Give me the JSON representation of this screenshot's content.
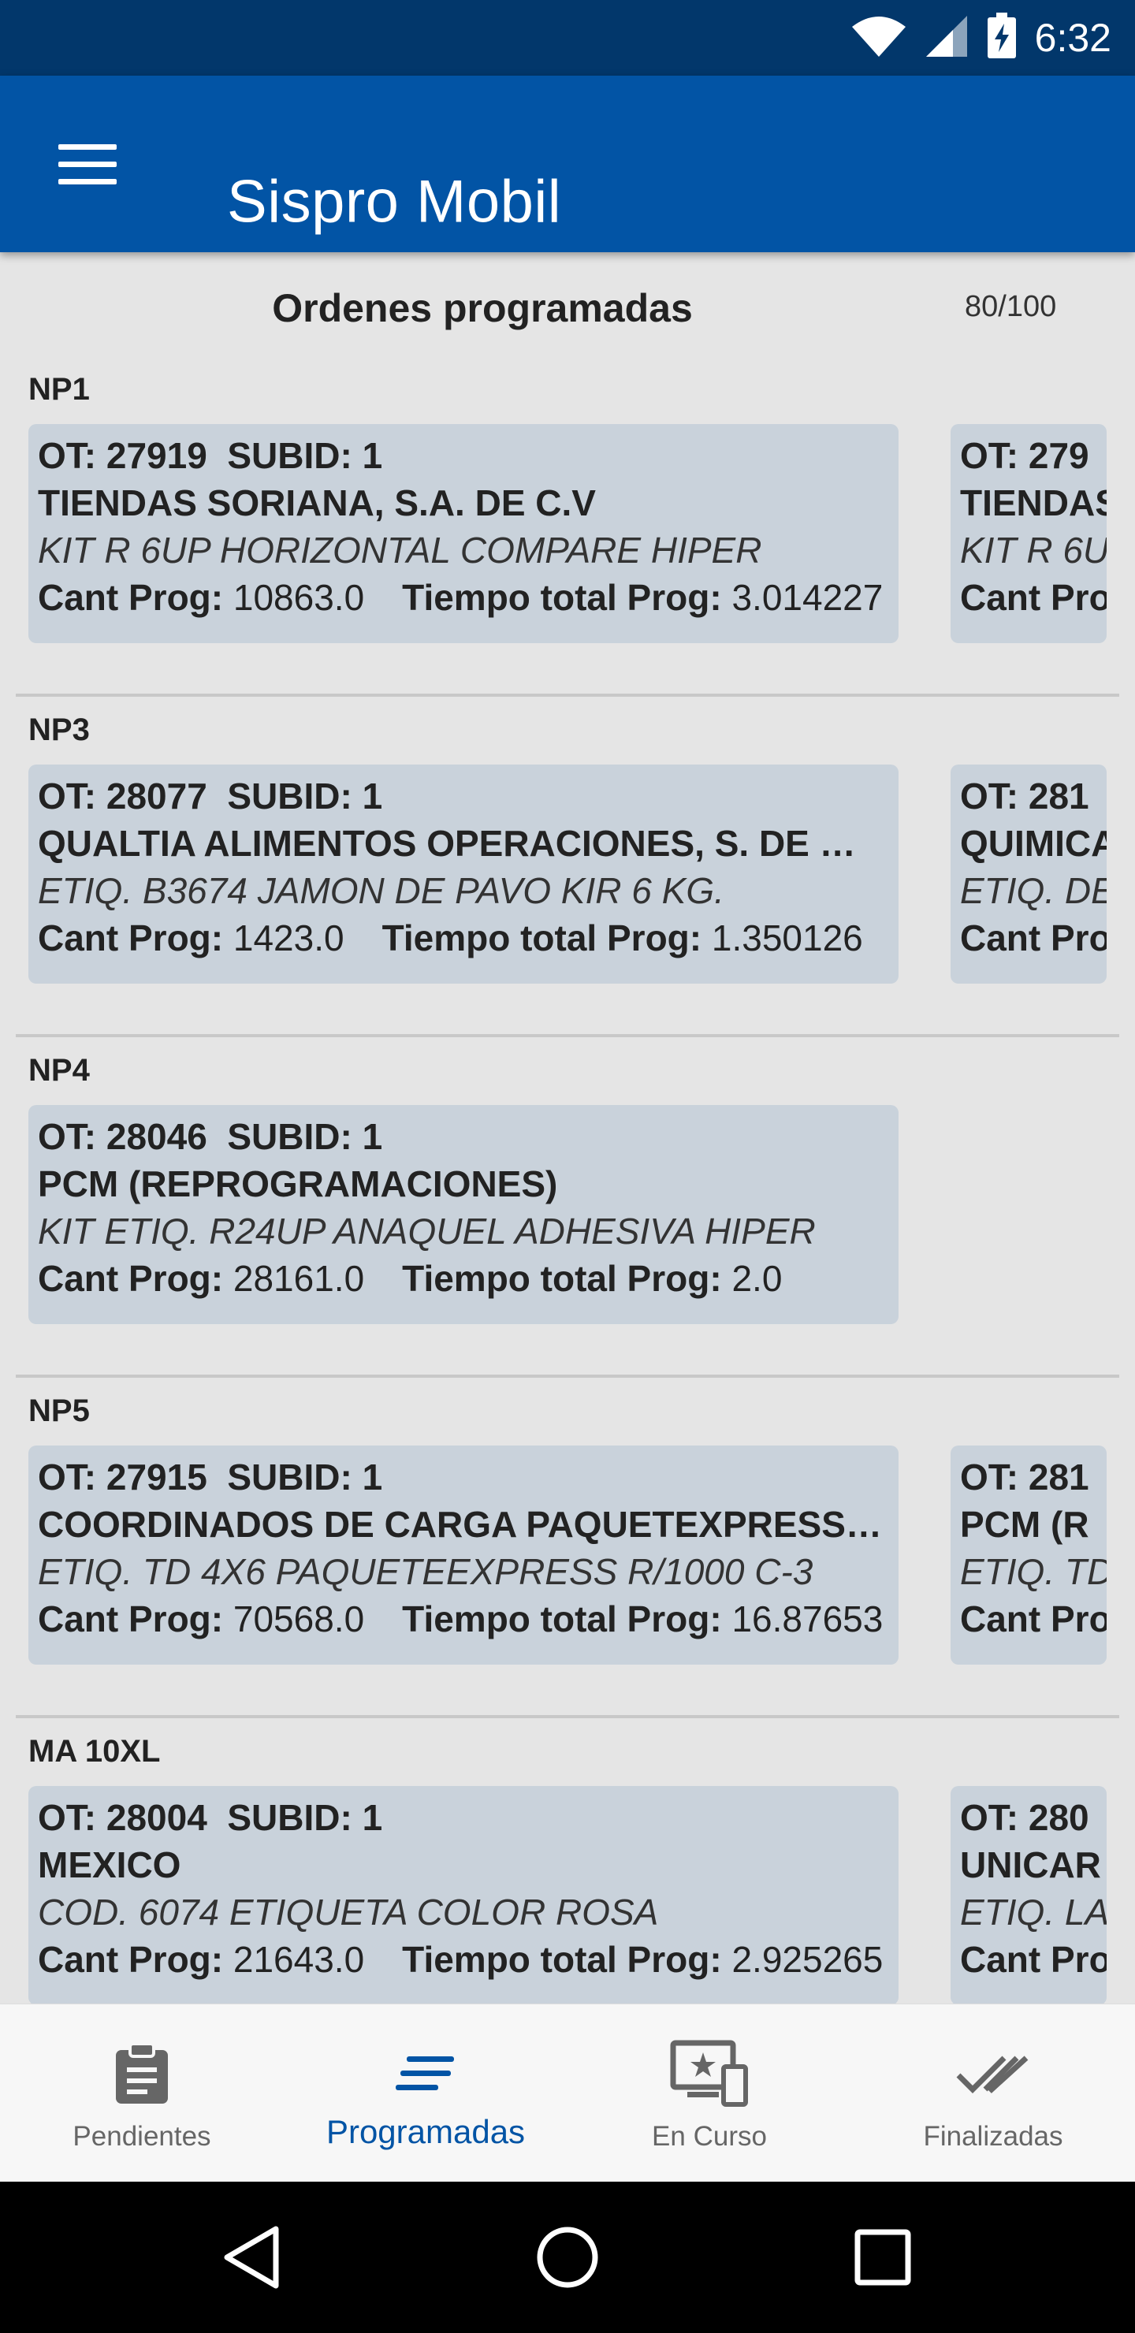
{
  "status_bar": {
    "time": "6:32",
    "icons": [
      "wifi-icon",
      "cell-signal-icon",
      "battery-charging-icon"
    ]
  },
  "app_bar": {
    "title": "Sispro Mobil",
    "menu_icon": "hamburger-menu-icon"
  },
  "page": {
    "title": "Ordenes programadas",
    "count": "80/100"
  },
  "sections": [
    {
      "name": "NP1",
      "cards": [
        {
          "ot_label": "OT:",
          "ot": "27919",
          "subid_label": "SUBID:",
          "subid": "1",
          "client": "TIENDAS SORIANA, S.A. DE C.V",
          "product": "KIT R 6UP HORIZONTAL COMPARE HIPER",
          "cant_label": "Cant Prog:",
          "cant": "10863.0",
          "tiempo_label": "Tiempo total Prog:",
          "tiempo": "3.014227"
        },
        {
          "ot_label": "OT:",
          "ot": "279",
          "client": "TIENDAS",
          "product": "KIT R 6U",
          "cant_label": "Cant Pro"
        }
      ]
    },
    {
      "name": "NP3",
      "cards": [
        {
          "ot_label": "OT:",
          "ot": "28077",
          "subid_label": "SUBID:",
          "subid": "1",
          "client": "QUALTIA ALIMENTOS OPERACIONES, S. DE …",
          "product": "ETIQ. B3674 JAMON DE PAVO KIR 6 KG.",
          "cant_label": "Cant Prog:",
          "cant": "1423.0",
          "tiempo_label": "Tiempo total Prog:",
          "tiempo": "1.350126"
        },
        {
          "ot_label": "OT:",
          "ot": "281",
          "client": "QUIMICA",
          "product": "ETIQ. DE",
          "cant_label": "Cant Pro"
        }
      ]
    },
    {
      "name": "NP4",
      "cards": [
        {
          "ot_label": "OT:",
          "ot": "28046",
          "subid_label": "SUBID:",
          "subid": "1",
          "client": "PCM  (REPROGRAMACIONES)",
          "product": "KIT ETIQ. R24UP ANAQUEL ADHESIVA HIPER",
          "cant_label": "Cant Prog:",
          "cant": "28161.0",
          "tiempo_label": "Tiempo total Prog:",
          "tiempo": "2.0"
        }
      ]
    },
    {
      "name": "NP5",
      "cards": [
        {
          "ot_label": "OT:",
          "ot": "27915",
          "subid_label": "SUBID:",
          "subid": "1",
          "client": "COORDINADOS DE CARGA PAQUETEXPRESS …",
          "product": "ETIQ. TD 4X6 PAQUETEEXPRESS R/1000 C-3",
          "cant_label": "Cant Prog:",
          "cant": "70568.0",
          "tiempo_label": "Tiempo total Prog:",
          "tiempo": "16.87653"
        },
        {
          "ot_label": "OT:",
          "ot": "281",
          "client": "PCM  (R",
          "product": "ETIQ. TD",
          "cant_label": "Cant Pro"
        }
      ]
    },
    {
      "name": "MA 10XL",
      "cards": [
        {
          "ot_label": "OT:",
          "ot": "28004",
          "subid_label": "SUBID:",
          "subid": "1",
          "client": "MEXICO",
          "product": "COD. 6074 ETIQUETA COLOR ROSA",
          "cant_label": "Cant Prog:",
          "cant": "21643.0",
          "tiempo_label": "Tiempo total Prog:",
          "tiempo": "2.925265"
        },
        {
          "ot_label": "OT:",
          "ot": "280",
          "client": "UNICAR",
          "product": "ETIQ. LA",
          "cant_label": "Cant Pro"
        }
      ]
    }
  ],
  "bottom_nav": [
    {
      "label": "Pendientes",
      "icon": "clipboard-icon",
      "active": false
    },
    {
      "label": "Programadas",
      "icon": "schedule-lines-icon",
      "active": true
    },
    {
      "label": "En Curso",
      "icon": "devices-star-icon",
      "active": false
    },
    {
      "label": "Finalizadas",
      "icon": "double-check-icon",
      "active": false
    }
  ],
  "system_nav": [
    "back-icon",
    "home-icon",
    "recents-icon"
  ],
  "colors": {
    "status_bar": "#02376b",
    "app_bar": "#0254a5",
    "card": "#c9d2db",
    "background": "#e5e5e5",
    "active_nav": "#0254a5"
  }
}
